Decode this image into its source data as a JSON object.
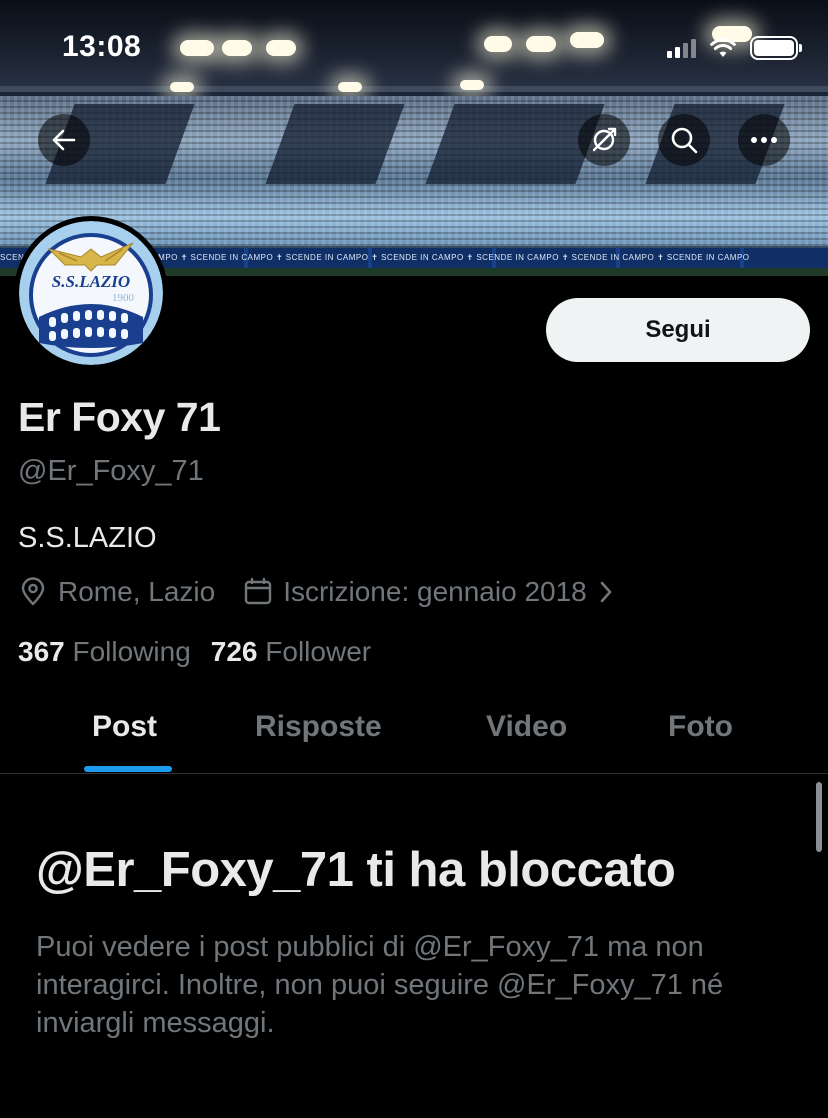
{
  "status_bar": {
    "time": "13:08"
  },
  "banner": {
    "board_text": "SCENDE IN CAMPO  ✝ SCENDE IN CAMPO  ✝ SCENDE IN CAMPO  ✝ SCENDE IN CAMPO  ✝ SCENDE IN CAMPO  ✝ SCENDE IN CAMPO  ✝ SCENDE IN CAMPO  ✝ SCENDE IN CAMPO"
  },
  "avatar": {
    "club_name": "S.S.LAZIO",
    "year": "1900"
  },
  "profile": {
    "follow_label": "Segui",
    "display_name": "Er Foxy 71",
    "handle": "@Er_Foxy_71",
    "bio": "S.S.LAZIO",
    "location": "Rome, Lazio",
    "joined": "Iscrizione: gennaio 2018",
    "following_count": "367",
    "following_label": "Following",
    "follower_count": "726",
    "follower_label": "Follower"
  },
  "tabs": [
    {
      "label": "Post",
      "active": true
    },
    {
      "label": "Risposte",
      "active": false
    },
    {
      "label": "Video",
      "active": false
    },
    {
      "label": "Foto",
      "active": false
    }
  ],
  "blocked": {
    "title": "@Er_Foxy_71 ti ha bloccato",
    "message": "Puoi vedere i post pubblici di @Er_Foxy_71 ma non interagirci. Inoltre, non puoi seguire @Er_Foxy_71 né inviargli messaggi."
  },
  "colors": {
    "background": "#000000",
    "primary_text": "#e7e9ea",
    "secondary_text": "#71767b",
    "accent": "#1d9bf0",
    "follow_button_bg": "#eff3f4"
  },
  "icons": [
    "back-arrow-icon",
    "translate-icon",
    "search-icon",
    "more-icon",
    "location-pin-icon",
    "calendar-icon",
    "chevron-right-icon",
    "wifi-icon",
    "signal-icon",
    "battery-icon"
  ]
}
